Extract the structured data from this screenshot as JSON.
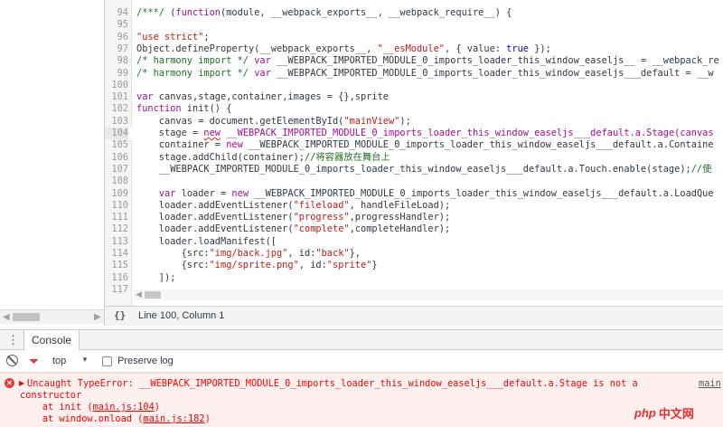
{
  "editor": {
    "lines": [
      {
        "n": "94",
        "t": "/***/ (function(module, __webpack_exports__, __webpack_require__) {"
      },
      {
        "n": "95",
        "t": ""
      },
      {
        "n": "96",
        "t": "\"use strict\";"
      },
      {
        "n": "97",
        "t": "Object.defineProperty(__webpack_exports__, \"__esModule\", { value: true });"
      },
      {
        "n": "98",
        "t": "/* harmony import */ var __WEBPACK_IMPORTED_MODULE_0_imports_loader_this_window_easeljs__ = __webpack_re"
      },
      {
        "n": "99",
        "t": "/* harmony import */ var __WEBPACK_IMPORTED_MODULE_0_imports_loader_this_window_easeljs___default = __w"
      },
      {
        "n": "100",
        "t": ""
      },
      {
        "n": "101",
        "t": "var canvas,stage,container,images = {},sprite"
      },
      {
        "n": "102",
        "t": "function init() {"
      },
      {
        "n": "103",
        "t": "    canvas = document.getElementById(\"mainView\");"
      },
      {
        "n": "104",
        "t": "    stage = new __WEBPACK_IMPORTED_MODULE_0_imports_loader_this_window_easeljs___default.a.Stage(canvas"
      },
      {
        "n": "105",
        "t": "    container = new __WEBPACK_IMPORTED_MODULE_0_imports_loader_this_window_easeljs___default.a.Containe"
      },
      {
        "n": "106",
        "t": "    stage.addChild(container);//将容器放在舞台上"
      },
      {
        "n": "107",
        "t": "    __WEBPACK_IMPORTED_MODULE_0_imports_loader_this_window_easeljs___default.a.Touch.enable(stage);//使"
      },
      {
        "n": "108",
        "t": ""
      },
      {
        "n": "109",
        "t": "    var loader = new __WEBPACK_IMPORTED_MODULE_0_imports_loader_this_window_easeljs___default.a.LoadQue"
      },
      {
        "n": "110",
        "t": "    loader.addEventListener(\"fileload\", handleFileLoad);"
      },
      {
        "n": "111",
        "t": "    loader.addEventListener(\"progress\",progressHandler);"
      },
      {
        "n": "112",
        "t": "    loader.addEventListener(\"complete\",completeHandler);"
      },
      {
        "n": "113",
        "t": "    loader.loadManifest(["
      },
      {
        "n": "114",
        "t": "        {src:\"img/back.jpg\", id:\"back\"},"
      },
      {
        "n": "115",
        "t": "        {src:\"img/sprite.png\", id:\"sprite\"}"
      },
      {
        "n": "116",
        "t": "    ]);"
      },
      {
        "n": "117",
        "t": ""
      }
    ],
    "highlight_line": "104"
  },
  "status": {
    "pretty_print_icon": "{}",
    "position": "Line 100, Column 1"
  },
  "drawer": {
    "menu_icon": "⋮",
    "tab_label": "Console"
  },
  "console_toolbar": {
    "clear_icon": "clear-console-icon",
    "filter_icon": "filter-icon",
    "context": "top",
    "preserve_log_label": "Preserve log"
  },
  "error": {
    "line1": "Uncaught TypeError: __WEBPACK_IMPORTED_MODULE_0_imports_loader_this_window_easeljs___default.a.Stage is not a",
    "line2": "constructor",
    "trace": [
      {
        "prefix": "    at init (",
        "link": "main.js:104",
        "suffix": ")"
      },
      {
        "prefix": "    at window.onload (",
        "link": "main.js:182",
        "suffix": ")"
      }
    ],
    "source_link": "main"
  },
  "watermark": {
    "logo": "php",
    "site": "中文网"
  },
  "colors": {
    "keyword": "#aa0d91",
    "string": "#c41a16",
    "comment": "#236e25",
    "error": "#ff0000"
  }
}
